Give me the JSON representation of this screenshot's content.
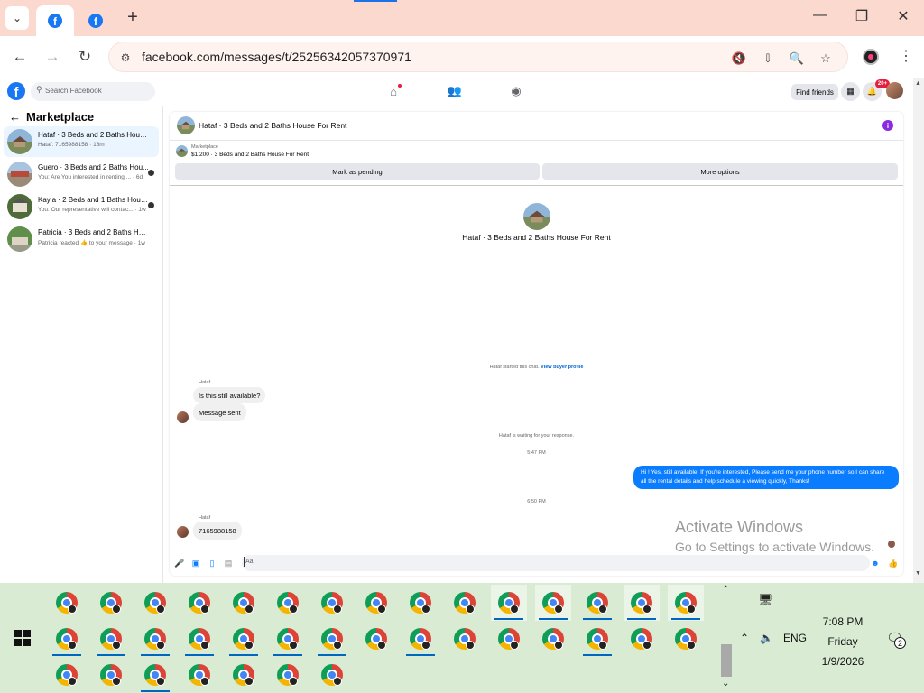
{
  "browser": {
    "url": "facebook.com/messages/t/25256342057370971",
    "tabs": [
      {
        "icon": "facebook-favicon",
        "active": true
      },
      {
        "icon": "facebook-favicon",
        "active": false
      }
    ]
  },
  "fb_header": {
    "search_placeholder": "Search Facebook",
    "find_friends": "Find friends",
    "notifications_badge": "20+"
  },
  "sidebar": {
    "title": "Marketplace",
    "conversations": [
      {
        "name": "Hataf · 3 Beds and 2 Baths House ...",
        "preview": "Hataf: 7165988158 · 18m",
        "selected": true
      },
      {
        "name": "Guero · 3 Beds and 2 Baths Hou...",
        "preview": "You: Are You interested in renting ... · 6d",
        "selected": false
      },
      {
        "name": "Kayla · 2 Beds and 1 Baths Hous...",
        "preview": "You: Our representative will contac... · 1w",
        "selected": false
      },
      {
        "name": "Patricia · 3 Beds and 2 Baths Hous...",
        "preview": "Patricia reacted 👍 to your message · 1w",
        "selected": false
      }
    ]
  },
  "chat": {
    "header_title": "Hataf · 3 Beds and 2 Baths House For Rent",
    "listing_source": "Marketplace",
    "listing_price_title": "$1,200 · 3 Beds and 2 Baths House For Rent",
    "mark_pending": "Mark as pending",
    "more_options": "More options",
    "hero_title": "Hataf · 3 Beds and 2 Baths House For Rent",
    "started_text": "Hataf started this chat.",
    "view_profile": "View buyer profile",
    "sender_1": "Hataf",
    "msg_1": "Is this still available?",
    "msg_2": "Message sent",
    "waiting": "Hataf is waiting for your response.",
    "time_1": "5:47 PM",
    "out_msg": "Hi ! Yes, still available. If you're interested, Please send me your phone number so I can share all the rental details and help schedule a viewing quickly, Thanks!",
    "time_2": "6:50 PM",
    "sender_2": "Hataf",
    "msg_3": "7165988158",
    "compose_placeholder": "Aa"
  },
  "watermark": {
    "line1": "Activate Windows",
    "line2": "Go to Settings to activate Windows."
  },
  "taskbar": {
    "lang": "ENG",
    "time": "7:08 PM",
    "day": "Friday",
    "date": "1/9/2026",
    "notif_count": "2"
  },
  "colors": {
    "facebook_blue": "#1877f2",
    "messenger_blue": "#0a7cff",
    "tab_strip": "#fbd9cf",
    "taskbar": "#d9ecd3"
  }
}
